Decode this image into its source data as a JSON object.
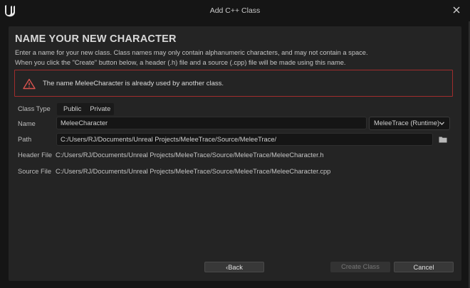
{
  "window": {
    "title": "Add C++ Class"
  },
  "heading": "NAME YOUR NEW CHARACTER",
  "description": {
    "line1": "Enter a name for your new class. Class names may only contain alphanumeric characters, and may not contain a space.",
    "line2": "When you click the \"Create\" button below, a header (.h) file and a source (.cpp) file will be made using this name."
  },
  "error": {
    "message": "The name MeleeCharacter is already used by another class."
  },
  "form": {
    "class_type": {
      "label": "Class Type",
      "options": [
        "Public",
        "Private"
      ]
    },
    "name": {
      "label": "Name",
      "value": "MeleeCharacter"
    },
    "module": {
      "value": "MeleeTrace (Runtime)"
    },
    "path": {
      "label": "Path",
      "value": "C:/Users/RJ/Documents/Unreal Projects/MeleeTrace/Source/MeleeTrace/"
    },
    "header_file": {
      "label": "Header File",
      "value": "C:/Users/RJ/Documents/Unreal Projects/MeleeTrace/Source/MeleeTrace/MeleeCharacter.h"
    },
    "source_file": {
      "label": "Source File",
      "value": "C:/Users/RJ/Documents/Unreal Projects/MeleeTrace/Source/MeleeTrace/MeleeCharacter.cpp"
    }
  },
  "buttons": {
    "back": "Back",
    "create": "Create Class",
    "cancel": "Cancel"
  },
  "icons": {
    "logo": "unreal-logo-icon",
    "close": "close-icon",
    "warning": "warning-triangle-icon",
    "dropdown": "chevron-down-icon",
    "folder": "folder-icon",
    "back": "chevron-left-icon"
  },
  "colors": {
    "error_border": "#a12d2d",
    "background": "#242424",
    "title_bar": "#151515"
  }
}
